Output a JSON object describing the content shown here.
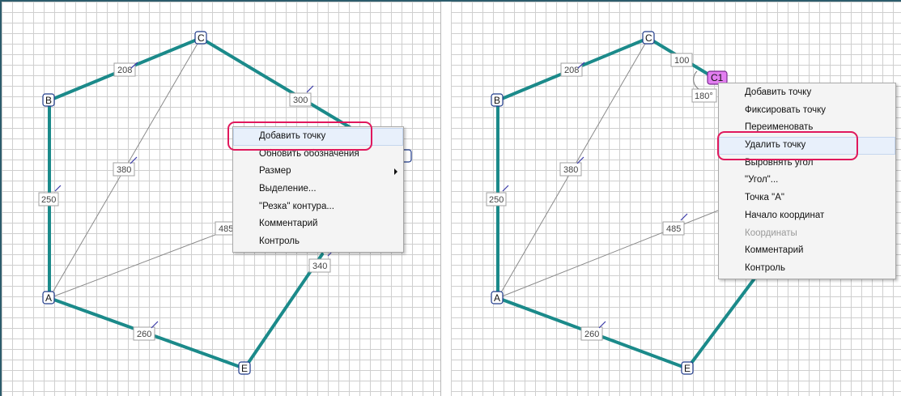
{
  "left_panel": {
    "vertices": {
      "A": "A",
      "B": "B",
      "C": "C",
      "E": "E"
    },
    "edge_labels": [
      "208",
      "300",
      "250",
      "380",
      "485",
      "340",
      "260"
    ],
    "context_menu": {
      "items": [
        {
          "label": "Добавить точку",
          "highlighted": true
        },
        {
          "label": "Обновить обозначения"
        },
        {
          "label": "Размер",
          "submenu": true
        },
        {
          "label": "Выделение..."
        },
        {
          "label": "\"Резка\" контура..."
        },
        {
          "label": "Комментарий"
        },
        {
          "label": "Контроль"
        }
      ]
    }
  },
  "right_panel": {
    "vertices": {
      "A": "A",
      "B": "B",
      "C": "C",
      "C1": "C1",
      "E": "E"
    },
    "edge_labels": [
      "208",
      "100",
      "250",
      "380",
      "485",
      "260"
    ],
    "angle_label": "180°",
    "context_menu": {
      "items": [
        {
          "label": "Добавить точку"
        },
        {
          "label": "Фиксировать точку"
        },
        {
          "label": "Переименовать"
        },
        {
          "label": "Удалить точку",
          "highlighted": true
        },
        {
          "label": "Выровнять угол"
        },
        {
          "label": "\"Угол\"..."
        },
        {
          "label": "Точка \"А\""
        },
        {
          "label": "Начало координат"
        },
        {
          "label": "Координаты",
          "disabled": true
        },
        {
          "label": "Комментарий"
        },
        {
          "label": "Контроль"
        }
      ]
    }
  },
  "colors": {
    "contour": "#1b8a8a",
    "highlight_ring": "#e0185c",
    "selected_vertex": "#e27ef0",
    "grid": "#cfcfcf"
  }
}
